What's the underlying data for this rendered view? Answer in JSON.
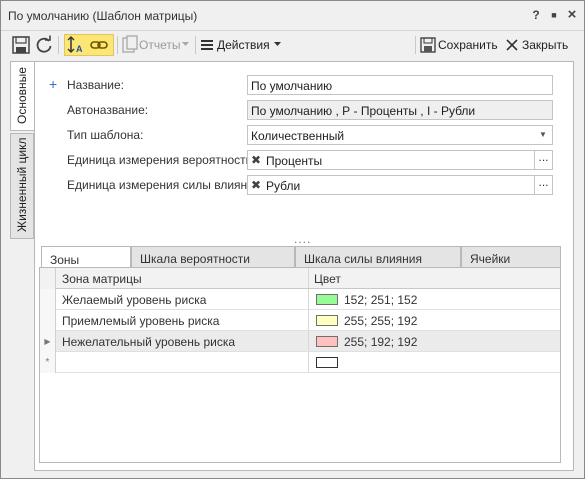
{
  "window": {
    "title": "По умолчанию (Шаблон матрицы)",
    "help_glyph": "?",
    "restore_glyph": "■",
    "close_glyph": "×"
  },
  "toolbar": {
    "reports_label": "Отчеты",
    "actions_label": "Действия",
    "save_label": "Сохранить",
    "close_label": "Закрыть"
  },
  "side_tabs": [
    {
      "label": "Основные",
      "active": true
    },
    {
      "label": "Жизненный цикл",
      "active": false
    }
  ],
  "form": {
    "name": {
      "label": "Название:",
      "value": "По умолчанию"
    },
    "autoname": {
      "label": "Автоназвание:",
      "value": "По умолчанию , Р - Проценты , I - Рубли"
    },
    "template_type": {
      "label": "Тип шаблона:",
      "value": "Количественный"
    },
    "probability_unit": {
      "label": "Единица измерения вероятности:",
      "value": "Проценты"
    },
    "impact_unit": {
      "label": "Единица измерения силы влияния:",
      "value": "Рубли"
    }
  },
  "splitter_glyph": "....",
  "tabs": [
    {
      "label": "Зоны",
      "active": true
    },
    {
      "label": "Шкала вероятности",
      "active": false
    },
    {
      "label": "Шкала силы влияния",
      "active": false
    },
    {
      "label": "Ячейки",
      "active": false
    }
  ],
  "grid": {
    "columns": [
      "Зона матрицы",
      "Цвет"
    ],
    "rows": [
      {
        "zone": "Желаемый уровень риска",
        "color_text": "152; 251; 152",
        "color": "#98fb98"
      },
      {
        "zone": "Приемлемый уровень риска",
        "color_text": "255; 255; 192",
        "color": "#ffffc0"
      },
      {
        "zone": "Нежелательный уровень риска",
        "color_text": "255; 192; 192",
        "color": "#ffc0c0",
        "current": true
      }
    ],
    "new_row_marker": "*",
    "current_row_marker": "▶"
  },
  "colors": {
    "accent_toolbar_active": "#fde774",
    "plus_icon": "#3a6cc6"
  }
}
